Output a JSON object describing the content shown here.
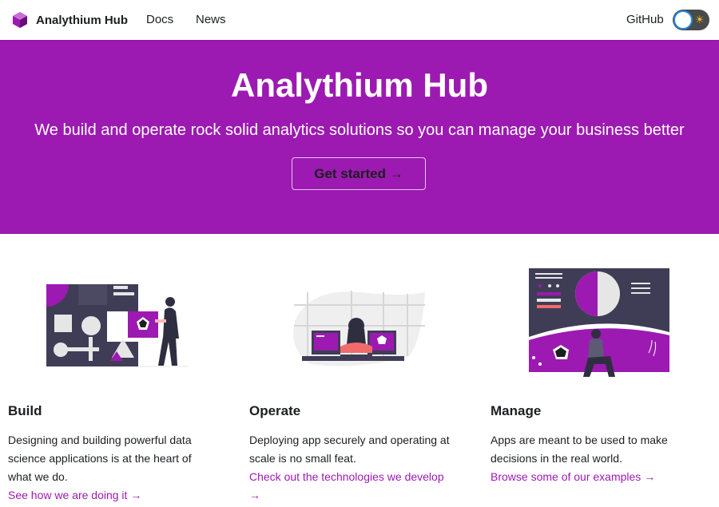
{
  "navbar": {
    "brand": "Analythium Hub",
    "links": [
      {
        "label": "Docs"
      },
      {
        "label": "News"
      },
      {
        "label": "GitHub"
      }
    ],
    "theme_toggle": {
      "state": "light",
      "icon": "sun-icon"
    }
  },
  "hero": {
    "title": "Analythium Hub",
    "subtitle": "We build and operate rock solid analytics solutions so you can manage your business better",
    "cta_label": "Get started →",
    "background_color": "#9c1ab1"
  },
  "features": [
    {
      "title": "Build",
      "text": "Designing and building powerful data science applications is at the heart of what we do.",
      "link": "See how we are doing it →",
      "illustration": "build-illustration"
    },
    {
      "title": "Operate",
      "text": "Deploying app securely and operating at scale is no small feat.",
      "link": "Check out the technologies we develop →",
      "illustration": "operate-illustration"
    },
    {
      "title": "Manage",
      "text": "Apps are meant to be used to make decisions in the real world.",
      "link": "Browse some of our examples →",
      "illustration": "manage-illustration"
    }
  ],
  "colors": {
    "accent": "#9c1ab1",
    "dark": "#3f3d56",
    "text": "#1c1e21"
  }
}
